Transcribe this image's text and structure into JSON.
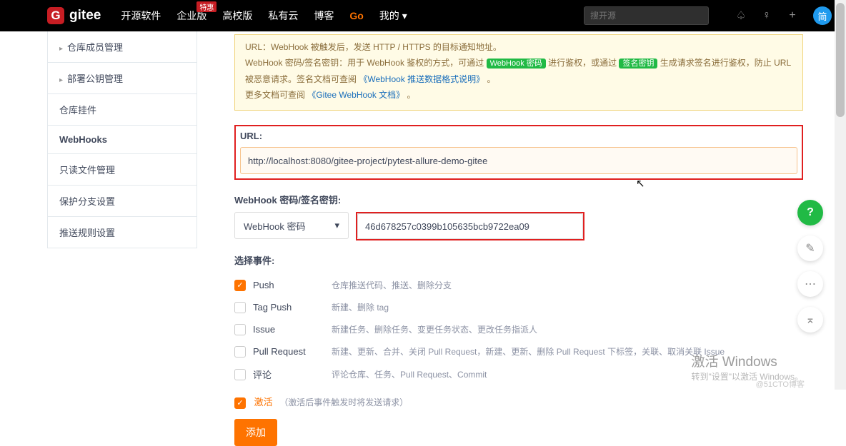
{
  "topbar": {
    "logo_letter": "G",
    "logo_text": "gitee",
    "nav": [
      "开源软件",
      "企业版",
      "高校版",
      "私有云",
      "博客",
      "Go",
      "我的"
    ],
    "hot": "特惠",
    "search_placeholder": "搜开源",
    "avatar": "简"
  },
  "sidebar": {
    "items": [
      {
        "label": "仓库成员管理",
        "parent": true
      },
      {
        "label": "部署公钥管理",
        "parent": true
      },
      {
        "label": "仓库挂件"
      },
      {
        "label": "WebHooks",
        "active": true
      },
      {
        "label": "只读文件管理"
      },
      {
        "label": "保护分支设置"
      },
      {
        "label": "推送规则设置"
      }
    ]
  },
  "info": {
    "line1_a": "URL：WebHook 被触发后，发送 HTTP / HTTPS 的目标通知地址。",
    "line2_a": "WebHook 密码/签名密钥：用于 WebHook 鉴权的方式，可通过 ",
    "tag1": "WebHook 密码",
    "line2_b": " 进行鉴权，或通过 ",
    "tag2": "签名密钥",
    "line2_c": " 生成请求签名进行鉴权，防止 URL 被恶意请求。签名文档可查阅 ",
    "link1": "《WebHook 推送数据格式说明》",
    "dot1": " 。",
    "line3_a": "更多文档可查阅 ",
    "link2": "《Gitee WebHook 文档》",
    "dot2": " 。"
  },
  "form": {
    "url_label": "URL:",
    "url_value": "http://localhost:8080/gitee-project/pytest-allure-demo-gitee",
    "pw_label": "WebHook 密码/签名密钥:",
    "pw_type": "WebHook 密码",
    "pw_value": "46d678257c0399b105635bcb9722ea09",
    "events_label": "选择事件:",
    "events": [
      {
        "name": "Push",
        "desc": "仓库推送代码、推送、删除分支",
        "checked": true
      },
      {
        "name": "Tag Push",
        "desc": "新建、删除 tag",
        "checked": false
      },
      {
        "name": "Issue",
        "desc": "新建任务、删除任务、变更任务状态、更改任务指派人",
        "checked": false
      },
      {
        "name": "Pull Request",
        "desc": "新建、更新、合并、关闭 Pull Request，新建、更新、删除 Pull Request 下标签，关联、取消关联 Issue",
        "checked": false
      },
      {
        "name": "评论",
        "desc": "评论仓库、任务、Pull Request、Commit",
        "checked": false
      }
    ],
    "activate_label": "激活",
    "activate_hint": "（激活后事件触发时将发送请求）",
    "submit": "添加"
  },
  "watermark": {
    "title": "激活 Windows",
    "sub": "转到\"设置\"以激活 Windows。"
  },
  "author": "@51CTO博客"
}
